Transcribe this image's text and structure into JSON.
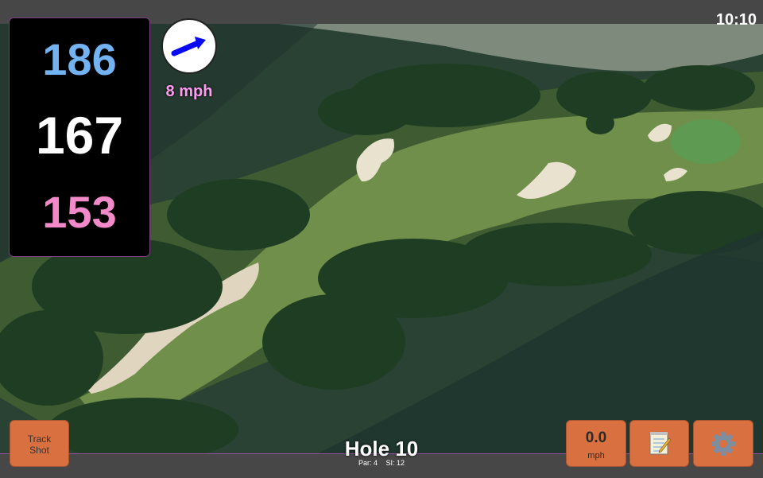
{
  "status": {
    "time": "10:10"
  },
  "yardage": {
    "back": "186",
    "middle": "167",
    "front": "153"
  },
  "wind": {
    "speed": "8 mph",
    "direction_icon": "arrow-icon",
    "arrow_color": "#0a0af0"
  },
  "hole": {
    "title": "Hole 10",
    "par": "Par: 4",
    "stroke_index": "SI: 12"
  },
  "buttons": {
    "track_shot": [
      "Track",
      "Shot"
    ],
    "speed_value": "0.0",
    "speed_unit": "mph",
    "notes_icon": "notepad-icon",
    "settings_icon": "gear-icon"
  },
  "colors": {
    "button": "#d9703f",
    "back_yardage": "#74b3f2",
    "middle_yardage": "#ffffff",
    "front_yardage": "#f28ac9",
    "wind_text": "#ff9cf0",
    "accent_border": "#9b4fa0"
  }
}
